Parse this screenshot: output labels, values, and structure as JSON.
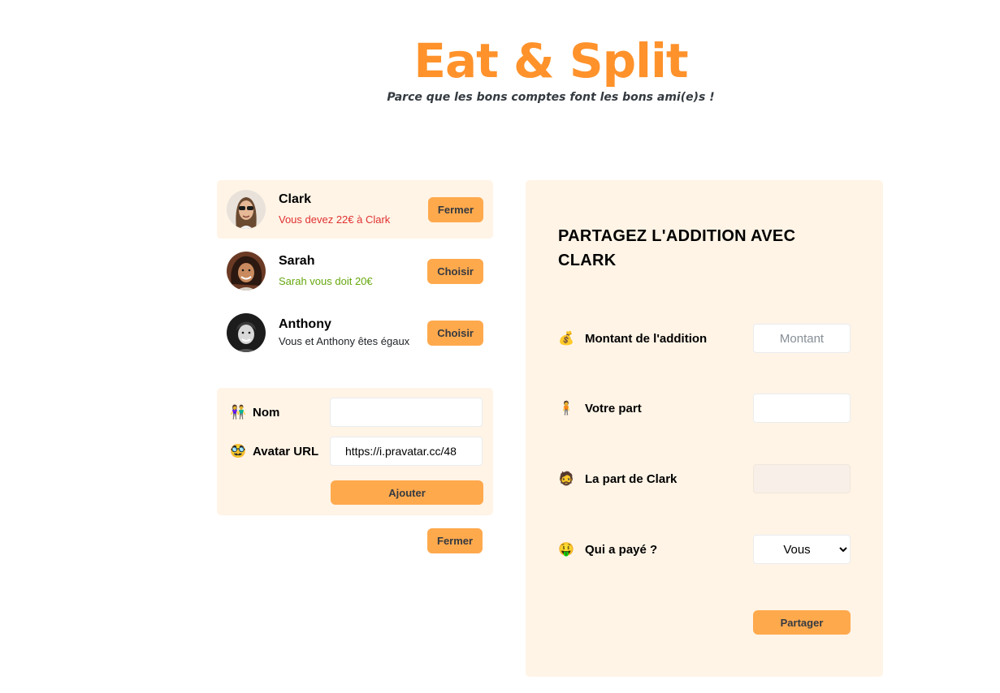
{
  "header": {
    "title": "Eat & Split",
    "subtitle": "Parce que les bons comptes font les bons ami(e)s !"
  },
  "friends": [
    {
      "name": "Clark",
      "status": "Vous devez 22€ à Clark",
      "status_tone": "red",
      "button": "Fermer"
    },
    {
      "name": "Sarah",
      "status": "Sarah vous doit 20€",
      "status_tone": "green",
      "button": "Choisir"
    },
    {
      "name": "Anthony",
      "status": "Vous et Anthony êtes égaux",
      "status_tone": "neutral",
      "button": "Choisir"
    }
  ],
  "add_form": {
    "name_icon": "people-icon",
    "name_label": "Nom",
    "name_value": "",
    "avatar_icon": "disguise-face-icon",
    "avatar_label": "Avatar URL",
    "avatar_value": "https://i.pravatar.cc/48",
    "submit": "Ajouter"
  },
  "close_button": "Fermer",
  "split_form": {
    "title": "PARTAGEZ L'ADDITION AVEC CLARK",
    "bill_icon": "money-bag-icon",
    "bill_label": "Montant de l'addition",
    "bill_placeholder": "Montant",
    "bill_value": "",
    "your_icon": "person-icon",
    "your_label": "Votre part",
    "your_value": "",
    "friend_icon": "man-icon",
    "friend_label": "La part de Clark",
    "friend_value": "",
    "payer_icon": "money-face-icon",
    "payer_label": "Qui a payé ?",
    "payer_selected": "Vous",
    "submit": "Partager"
  },
  "colors": {
    "accent": "#ff922b",
    "button": "#ffa94d",
    "panel": "#fff4e6",
    "owe": "#e03131",
    "owed": "#66a80f"
  }
}
